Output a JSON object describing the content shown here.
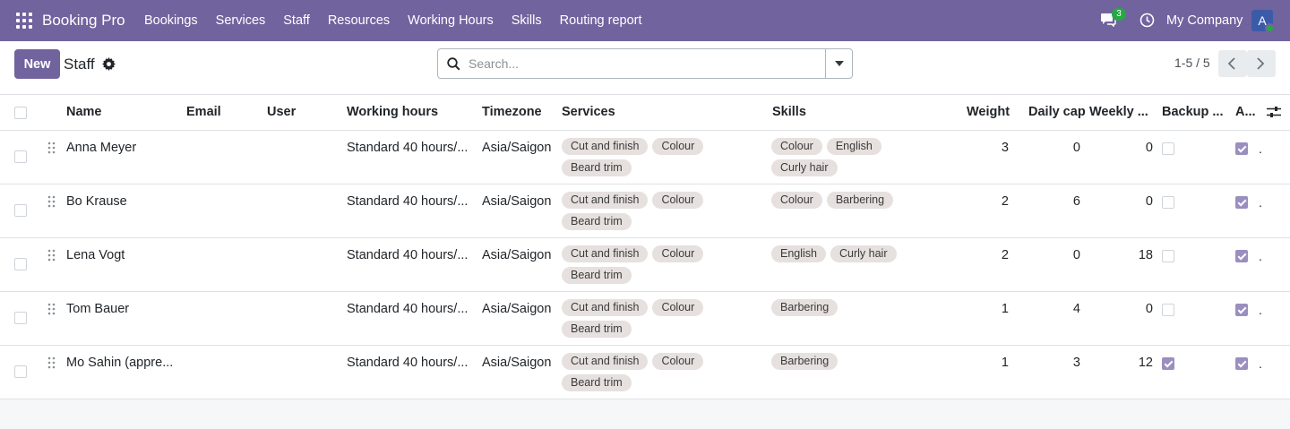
{
  "nav": {
    "brand": "Booking Pro",
    "menu": [
      "Bookings",
      "Services",
      "Staff",
      "Resources",
      "Working Hours",
      "Skills",
      "Routing report"
    ],
    "chat_badge": "3",
    "company": "My Company",
    "avatar_letter": "A",
    "accent": "#71639e"
  },
  "control": {
    "new_label": "New",
    "title": "Staff",
    "search_placeholder": "Search...",
    "pager": "1-5 / 5"
  },
  "table": {
    "headers": {
      "name": "Name",
      "email": "Email",
      "user": "User",
      "working_hours": "Working hours",
      "timezone": "Timezone",
      "services": "Services",
      "skills": "Skills",
      "weight": "Weight",
      "daily_cap": "Daily cap",
      "weekly_cap": "Weekly ...",
      "backup": "Backup ...",
      "active": "A..."
    },
    "rows": [
      {
        "name": "Anna Meyer",
        "email": "",
        "user": "",
        "working_hours": "Standard 40 hours/...",
        "timezone": "Asia/Saigon",
        "services": [
          "Cut and finish",
          "Colour",
          "Beard trim"
        ],
        "skills": [
          "Colour",
          "English",
          "Curly hair"
        ],
        "weight": "3",
        "daily_cap": "0",
        "weekly_cap": "0",
        "backup": false,
        "active": true,
        "extra": "."
      },
      {
        "name": "Bo Krause",
        "email": "",
        "user": "",
        "working_hours": "Standard 40 hours/...",
        "timezone": "Asia/Saigon",
        "services": [
          "Cut and finish",
          "Colour",
          "Beard trim"
        ],
        "skills": [
          "Colour",
          "Barbering"
        ],
        "weight": "2",
        "daily_cap": "6",
        "weekly_cap": "0",
        "backup": false,
        "active": true,
        "extra": "."
      },
      {
        "name": "Lena Vogt",
        "email": "",
        "user": "",
        "working_hours": "Standard 40 hours/...",
        "timezone": "Asia/Saigon",
        "services": [
          "Cut and finish",
          "Colour",
          "Beard trim"
        ],
        "skills": [
          "English",
          "Curly hair"
        ],
        "weight": "2",
        "daily_cap": "0",
        "weekly_cap": "18",
        "backup": false,
        "active": true,
        "extra": "."
      },
      {
        "name": "Tom Bauer",
        "email": "",
        "user": "",
        "working_hours": "Standard 40 hours/...",
        "timezone": "Asia/Saigon",
        "services": [
          "Cut and finish",
          "Colour",
          "Beard trim"
        ],
        "skills": [
          "Barbering"
        ],
        "weight": "1",
        "daily_cap": "4",
        "weekly_cap": "0",
        "backup": false,
        "active": true,
        "extra": "."
      },
      {
        "name": "Mo Sahin (appre...",
        "email": "",
        "user": "",
        "working_hours": "Standard 40 hours/...",
        "timezone": "Asia/Saigon",
        "services": [
          "Cut and finish",
          "Colour",
          "Beard trim"
        ],
        "skills": [
          "Barbering"
        ],
        "weight": "1",
        "daily_cap": "3",
        "weekly_cap": "12",
        "backup": true,
        "active": true,
        "extra": "."
      }
    ]
  }
}
